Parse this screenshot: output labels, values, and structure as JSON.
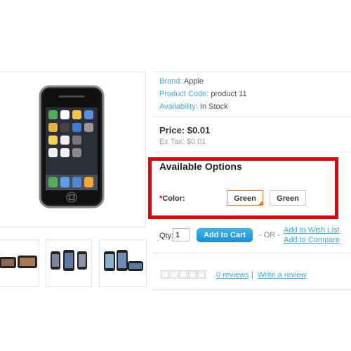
{
  "product": {
    "brand_label": "Brand:",
    "brand_value": "Apple",
    "code_label": "Product Code:",
    "code_value": "product 11",
    "availability_label": "Availability:",
    "availability_value": "In Stock",
    "price": "Price: $0.01",
    "ex_tax": "Ex Tax: $0.01"
  },
  "options": {
    "title": "Available Options",
    "required_mark": "*",
    "color_label": "Color:",
    "choices": [
      "Green",
      "Green"
    ],
    "selected_index": 0
  },
  "cart": {
    "qty_label": "Qty:",
    "qty_value": "1",
    "add_to_cart": "Add to Cart",
    "or_text": "- OR -",
    "wish_list": "Add to Wish List",
    "compare": "Add to Compare"
  },
  "reviews": {
    "rating": 0,
    "max": 5,
    "reviews_link": "0 reviews",
    "separator": "|",
    "write_link": "Write a review"
  },
  "colors": {
    "link": "#38b0e3",
    "button": "#1a8fd6",
    "highlight": "#e60000",
    "selected_border": "#f07a2a"
  }
}
